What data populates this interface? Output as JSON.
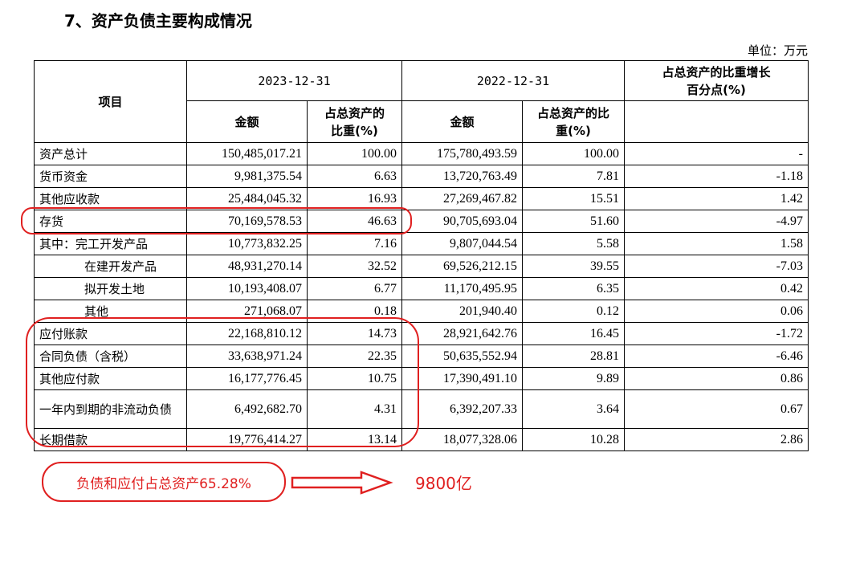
{
  "heading": "7、资产负债主要构成情况",
  "unit": "单位：万元",
  "table": {
    "col_item": "项目",
    "date_2023": "2023-12-31",
    "date_2022": "2022-12-31",
    "change_header": "占总资产的比重增长百分点(%)",
    "amount": "金额",
    "ratio": "占总资产的比重(%)",
    "rows": [
      {
        "name": "资产总计",
        "a23": "150,485,017.21",
        "r23": "100.00",
        "a22": "175,780,493.59",
        "r22": "100.00",
        "chg": "-"
      },
      {
        "name": "货币资金",
        "a23": "9,981,375.54",
        "r23": "6.63",
        "a22": "13,720,763.49",
        "r22": "7.81",
        "chg": "-1.18"
      },
      {
        "name": "其他应收款",
        "a23": "25,484,045.32",
        "r23": "16.93",
        "a22": "27,269,467.82",
        "r22": "15.51",
        "chg": "1.42"
      },
      {
        "name": "存货",
        "a23": "70,169,578.53",
        "r23": "46.63",
        "a22": "90,705,693.04",
        "r22": "51.60",
        "chg": "-4.97"
      },
      {
        "name": "其中：完工开发产品",
        "a23": "10,773,832.25",
        "r23": "7.16",
        "a22": "9,807,044.54",
        "r22": "5.58",
        "chg": "1.58"
      },
      {
        "name": "在建开发产品",
        "a23": "48,931,270.14",
        "r23": "32.52",
        "a22": "69,526,212.15",
        "r22": "39.55",
        "chg": "-7.03"
      },
      {
        "name": "拟开发土地",
        "a23": "10,193,408.07",
        "r23": "6.77",
        "a22": "11,170,495.95",
        "r22": "6.35",
        "chg": "0.42"
      },
      {
        "name": "其他",
        "a23": "271,068.07",
        "r23": "0.18",
        "a22": "201,940.40",
        "r22": "0.12",
        "chg": "0.06"
      },
      {
        "name": "应付账款",
        "a23": "22,168,810.12",
        "r23": "14.73",
        "a22": "28,921,642.76",
        "r22": "16.45",
        "chg": "-1.72"
      },
      {
        "name": "合同负债（含税）",
        "a23": "33,638,971.24",
        "r23": "22.35",
        "a22": "50,635,552.94",
        "r22": "28.81",
        "chg": "-6.46"
      },
      {
        "name": "其他应付款",
        "a23": "16,177,776.45",
        "r23": "10.75",
        "a22": "17,390,491.10",
        "r22": "9.89",
        "chg": "0.86"
      },
      {
        "name": "一年内到期的非流动负债",
        "a23": "6,492,682.70",
        "r23": "4.31",
        "a22": "6,392,207.33",
        "r22": "3.64",
        "chg": "0.67"
      },
      {
        "name": "长期借款",
        "a23": "19,776,414.27",
        "r23": "13.14",
        "a22": "18,077,328.06",
        "r22": "10.28",
        "chg": "2.86"
      }
    ]
  },
  "annotations": {
    "note": "负债和应付占总资产65.28%",
    "result": "9800亿",
    "color": "#e02020"
  }
}
